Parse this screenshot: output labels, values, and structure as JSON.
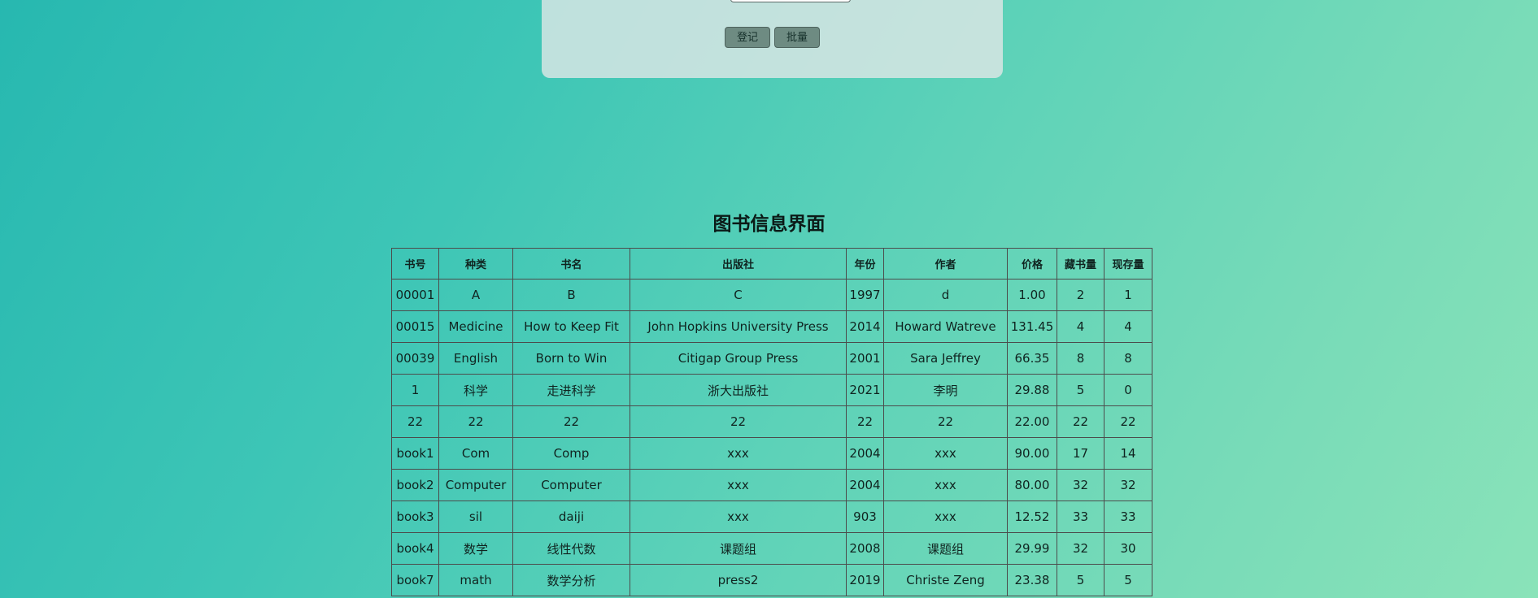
{
  "form": {
    "register_label": "登记",
    "batch_label": "批量"
  },
  "page_title": "图书信息界面",
  "table": {
    "headers": [
      "书号",
      "种类",
      "书名",
      "出版社",
      "年份",
      "作者",
      "价格",
      "藏书量",
      "现存量"
    ],
    "rows": [
      [
        "00001",
        "A",
        "B",
        "C",
        "1997",
        "d",
        "1.00",
        "2",
        "1"
      ],
      [
        "00015",
        "Medicine",
        "How to Keep Fit",
        "John Hopkins University Press",
        "2014",
        "Howard Watreve",
        "131.45",
        "4",
        "4"
      ],
      [
        "00039",
        "English",
        "Born to Win",
        "Citigap Group Press",
        "2001",
        "Sara Jeffrey",
        "66.35",
        "8",
        "8"
      ],
      [
        "1",
        "科学",
        "走进科学",
        "浙大出版社",
        "2021",
        "李明",
        "29.88",
        "5",
        "0"
      ],
      [
        "22",
        "22",
        "22",
        "22",
        "22",
        "22",
        "22.00",
        "22",
        "22"
      ],
      [
        "book1",
        "Com",
        "Comp",
        "xxx",
        "2004",
        "xxx",
        "90.00",
        "17",
        "14"
      ],
      [
        "book2",
        "Computer",
        "Computer",
        "xxx",
        "2004",
        "xxx",
        "80.00",
        "32",
        "32"
      ],
      [
        "book3",
        "sil",
        "daiji",
        "xxx",
        "903",
        "xxx",
        "12.52",
        "33",
        "33"
      ],
      [
        "book4",
        "数学",
        "线性代数",
        "课题组",
        "2008",
        "课题组",
        "29.99",
        "32",
        "30"
      ],
      [
        "book7",
        "math",
        "数学分析",
        "press2",
        "2019",
        "Christe Zeng",
        "23.38",
        "5",
        "5"
      ]
    ]
  }
}
